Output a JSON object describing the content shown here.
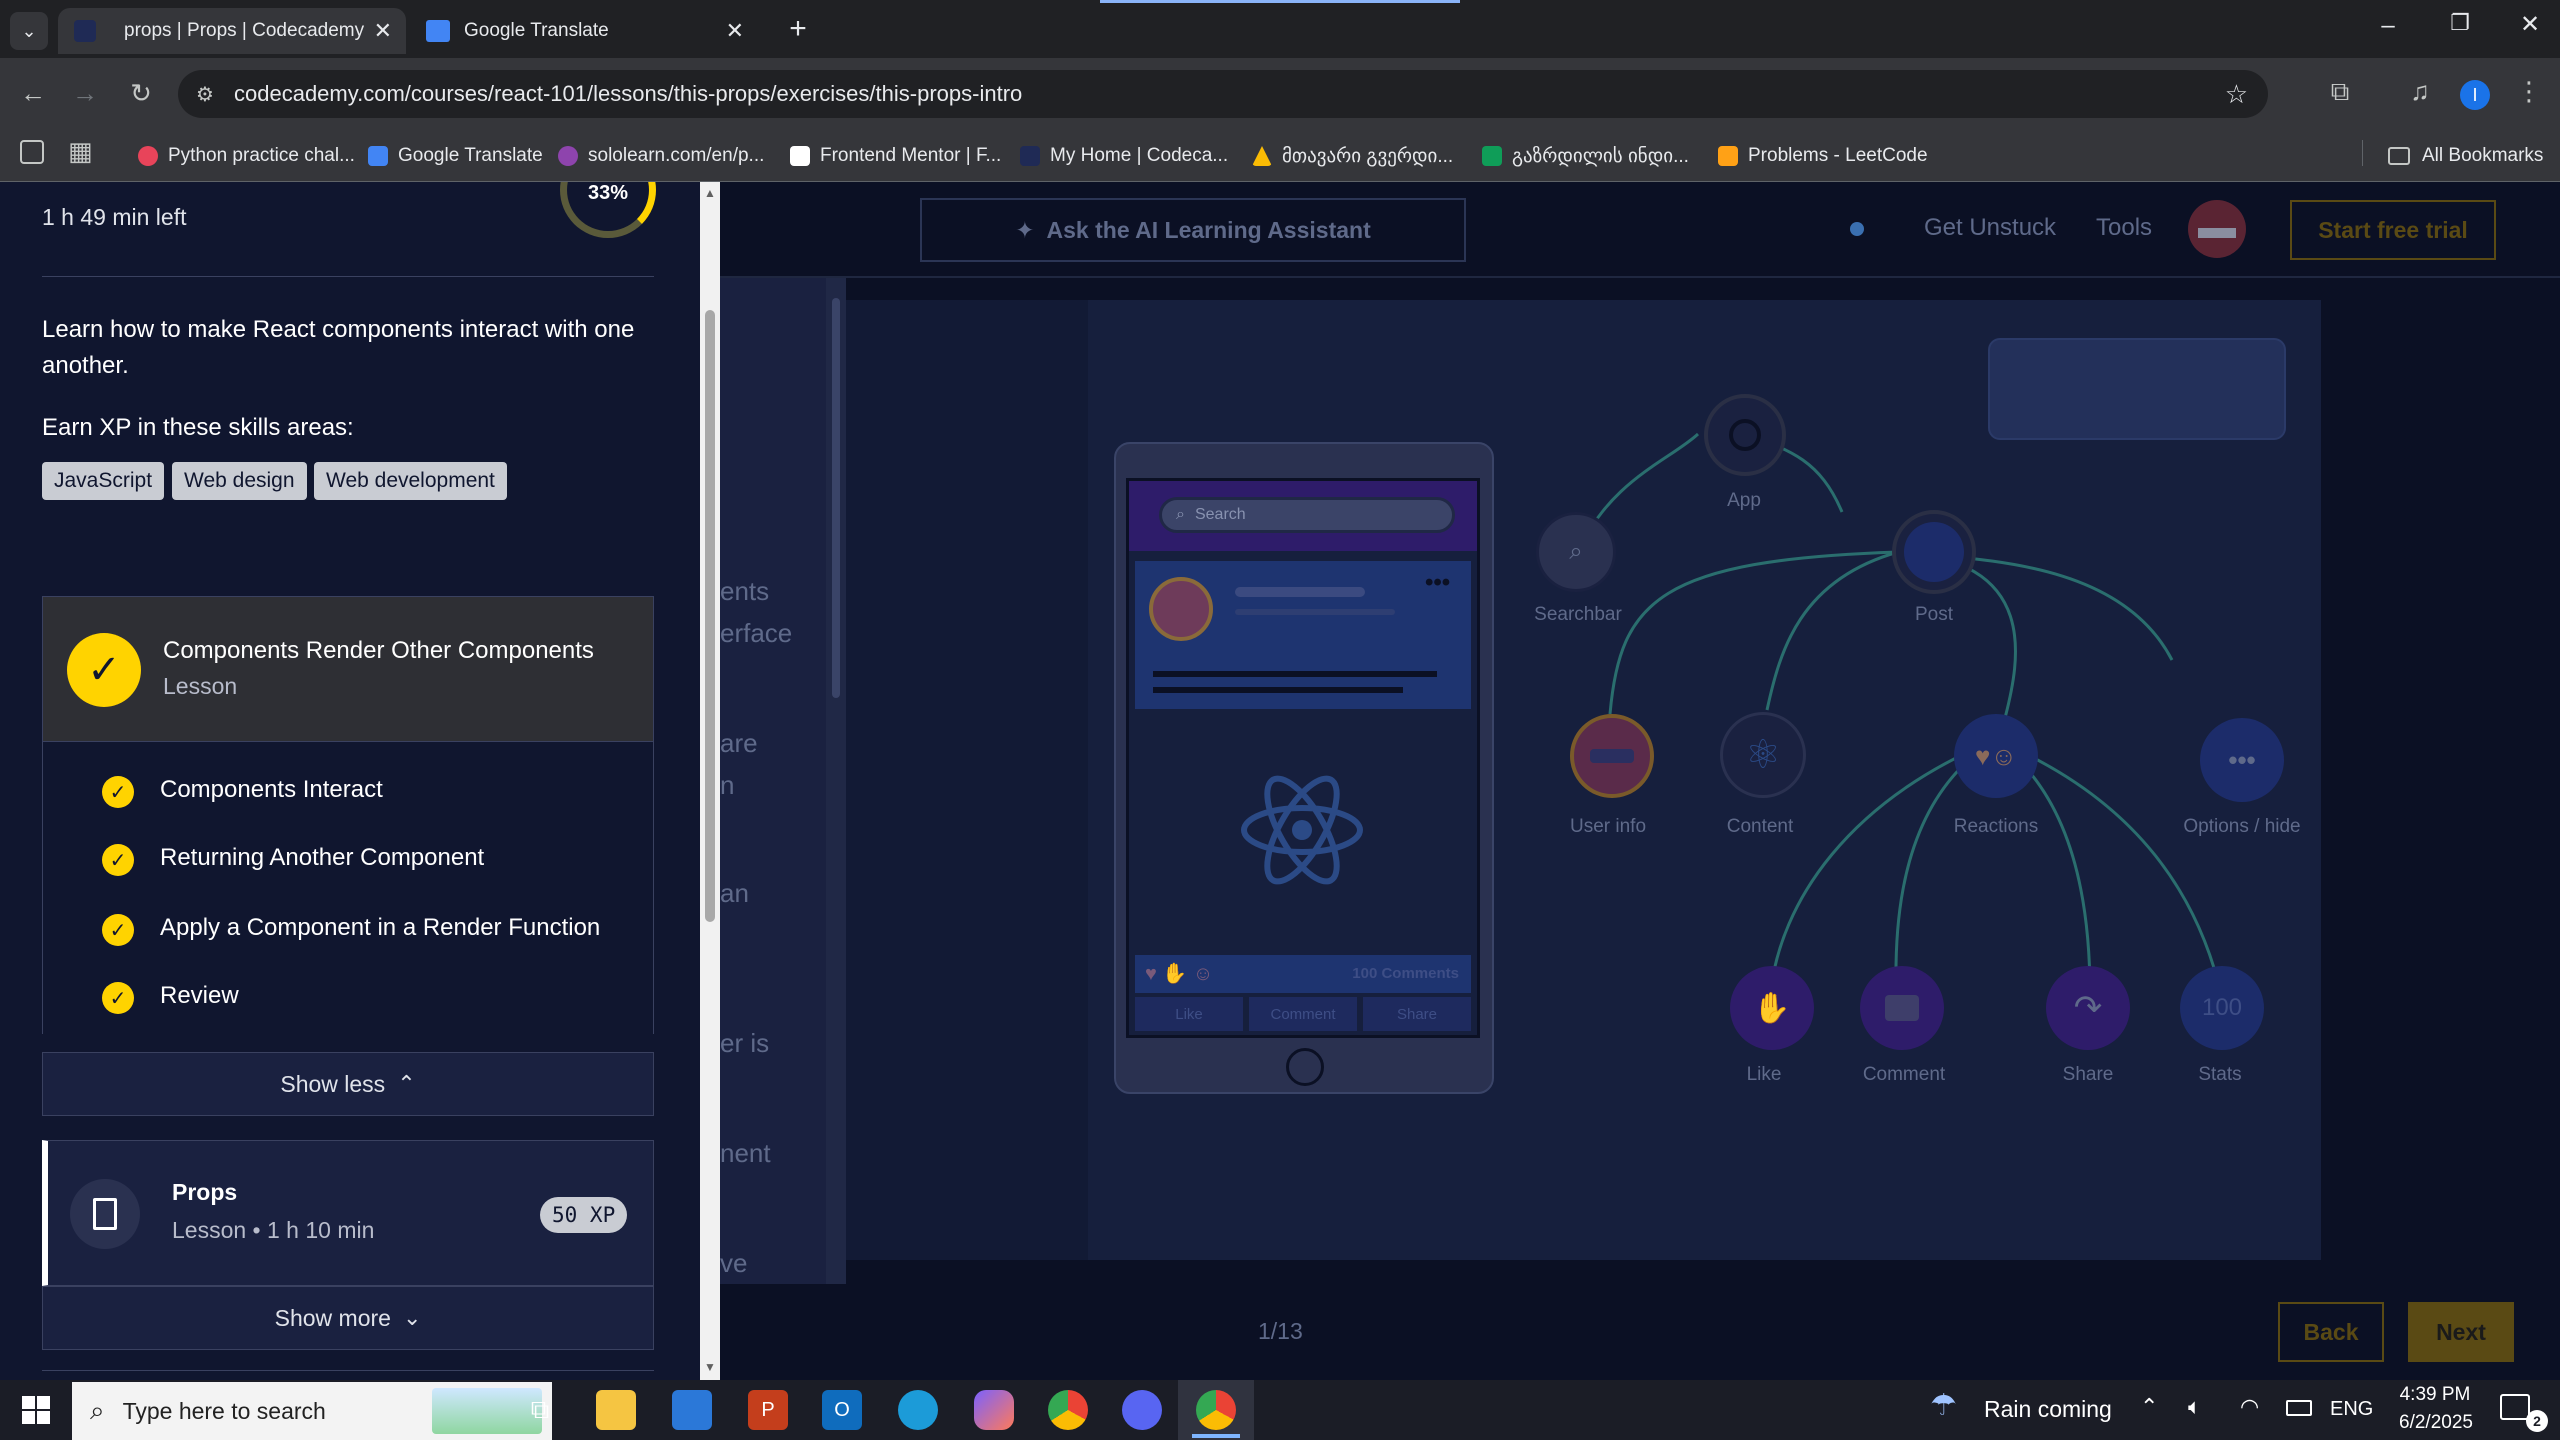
{
  "browser": {
    "tabs": [
      {
        "title": "props | Props | Codecademy",
        "active": true
      },
      {
        "title": "Google Translate",
        "active": false
      }
    ],
    "url": "codecademy.com/courses/react-101/lessons/this-props/exercises/this-props-intro",
    "bookmarks": [
      "Python practice chal...",
      "Google Translate",
      "sololearn.com/en/p...",
      "Frontend Mentor | F...",
      "My Home | Codeca...",
      "მთავარი გვერდი...",
      "გაზრდილის ინდი...",
      "Problems - LeetCode"
    ],
    "all_bookmarks": "All Bookmarks",
    "profile_initial": "I"
  },
  "sidebar": {
    "progress": "33%",
    "time_left": "1 h 49 min left",
    "description": "Learn how to make React components interact with one another.",
    "xp_heading": "Earn XP in these skills areas:",
    "skills": [
      "JavaScript",
      "Web design",
      "Web development"
    ],
    "completed_lesson": {
      "title": "Components Render Other Components",
      "type": "Lesson"
    },
    "exercises": [
      "Components Interact",
      "Returning Another Component",
      "Apply a Component in a Render Function",
      "Review"
    ],
    "show_less": "Show less",
    "current_lesson": {
      "title": "Props",
      "meta": "Lesson • 1 h 10 min",
      "xp": "50 XP"
    },
    "show_more": "Show more"
  },
  "main": {
    "ai_assistant": "Ask the AI Learning Assistant",
    "get_unstuck": "Get Unstuck",
    "tools": "Tools",
    "start_trial": "Start free trial",
    "narrative_fragments": [
      "ents",
      "erface",
      "are",
      "n",
      "an",
      "er is",
      "nent",
      "ve"
    ],
    "phone": {
      "search": "Search",
      "comments": "100 Comments",
      "actions": [
        "Like",
        "Comment",
        "Share"
      ]
    },
    "tree_nodes": [
      "App",
      "Searchbar",
      "Post",
      "User info",
      "Content",
      "Reactions",
      "Options / hide",
      "Like",
      "Comment",
      "Share",
      "Stats"
    ],
    "stats_value": "100",
    "pagination": "1/13",
    "back": "Back",
    "next": "Next"
  },
  "taskbar": {
    "search_placeholder": "Type here to search",
    "weather": "Rain coming",
    "lang": "ENG",
    "time": "4:39 PM",
    "date": "6/2/2025",
    "notifications": "2"
  }
}
